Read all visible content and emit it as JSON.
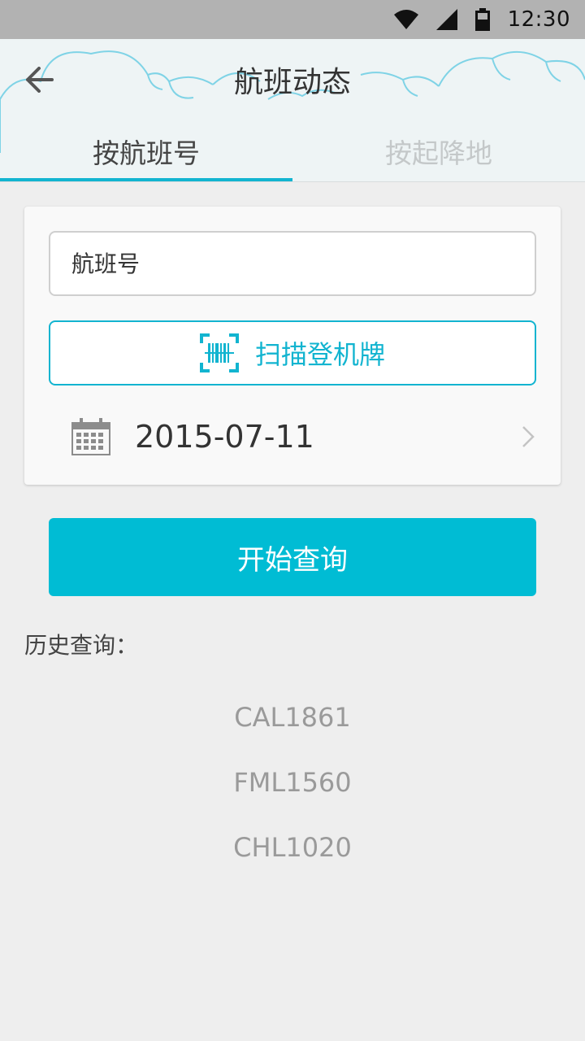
{
  "status_bar": {
    "time": "12:30",
    "icons": [
      "wifi-icon",
      "cellular-signal-icon",
      "battery-icon"
    ]
  },
  "header": {
    "title": "航班动态",
    "back_icon": "arrow-left-icon",
    "tabs": [
      {
        "label": "按航班号",
        "active": true
      },
      {
        "label": "按起降地",
        "active": false
      }
    ]
  },
  "form": {
    "flight_number_placeholder": "航班号",
    "scan_label": "扫描登机牌",
    "scan_icon": "barcode-scan-icon",
    "date_value": "2015-07-11",
    "date_icon": "calendar-icon"
  },
  "search_button_label": "开始查询",
  "history": {
    "label": "历史查询：",
    "items": [
      "CAL1861",
      "FML1560",
      "CHL1020"
    ]
  },
  "colors": {
    "accent": "#00bcd4",
    "tab_indicator": "#12b4d0",
    "background": "#eeeeee",
    "status_bar": "#b2b2b2"
  }
}
